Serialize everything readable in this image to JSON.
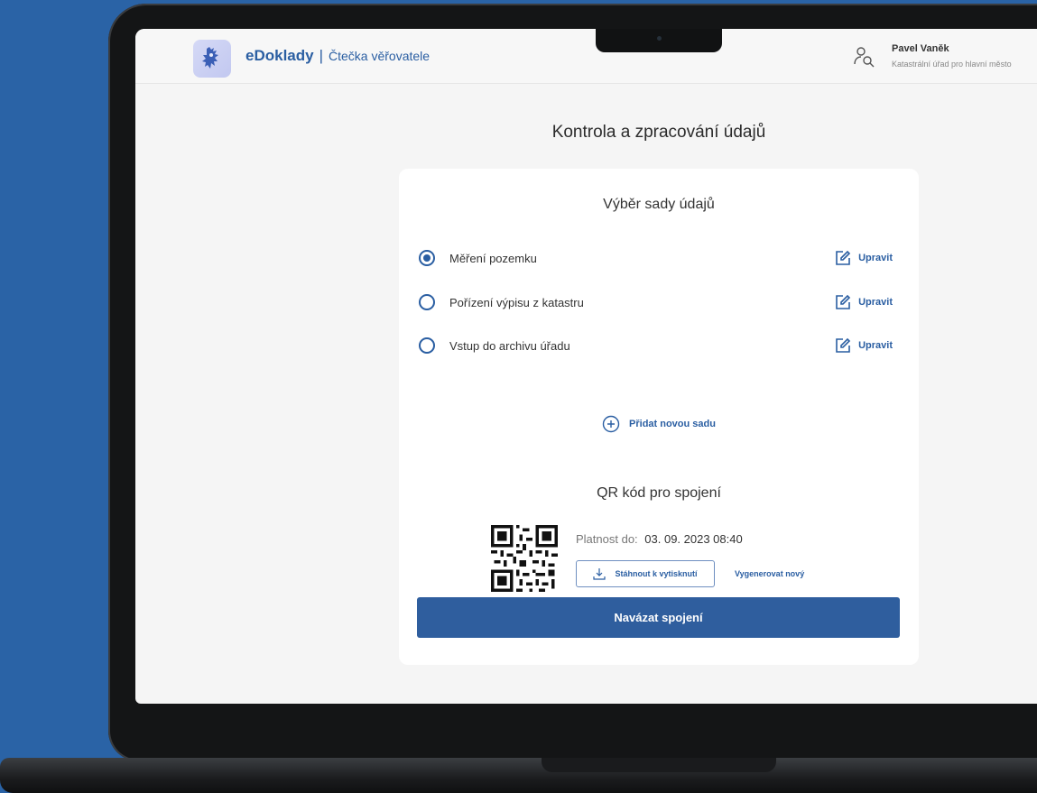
{
  "header": {
    "brand": "eDoklady",
    "separator": "|",
    "subtitle": "Čtečka věřovatele",
    "user_name": "Pavel Vaněk",
    "user_org": "Katastrální úřad pro hlavní město"
  },
  "page": {
    "title": "Kontrola a zpracování údajů"
  },
  "data_sets": {
    "title": "Výběr sady údajů",
    "items": [
      {
        "label": "Měření pozemku",
        "selected": true,
        "edit_label": "Upravit"
      },
      {
        "label": "Pořízení výpisu z katastru",
        "selected": false,
        "edit_label": "Upravit"
      },
      {
        "label": "Vstup do archivu úřadu",
        "selected": false,
        "edit_label": "Upravit"
      }
    ],
    "add_label": "Přidat novou sadu"
  },
  "qr": {
    "title": "QR kód pro spojení",
    "validity_label": "Platnost do:",
    "validity_value": "03. 09. 2023 08:40",
    "download_label": "Stáhnout k vytisknutí",
    "regenerate_label": "Vygenerovat nový"
  },
  "actions": {
    "connect_label": "Navázat spojení"
  },
  "colors": {
    "background": "#2a63a6",
    "accent": "#2a5ea2",
    "primary_button": "#2f5e9e"
  }
}
